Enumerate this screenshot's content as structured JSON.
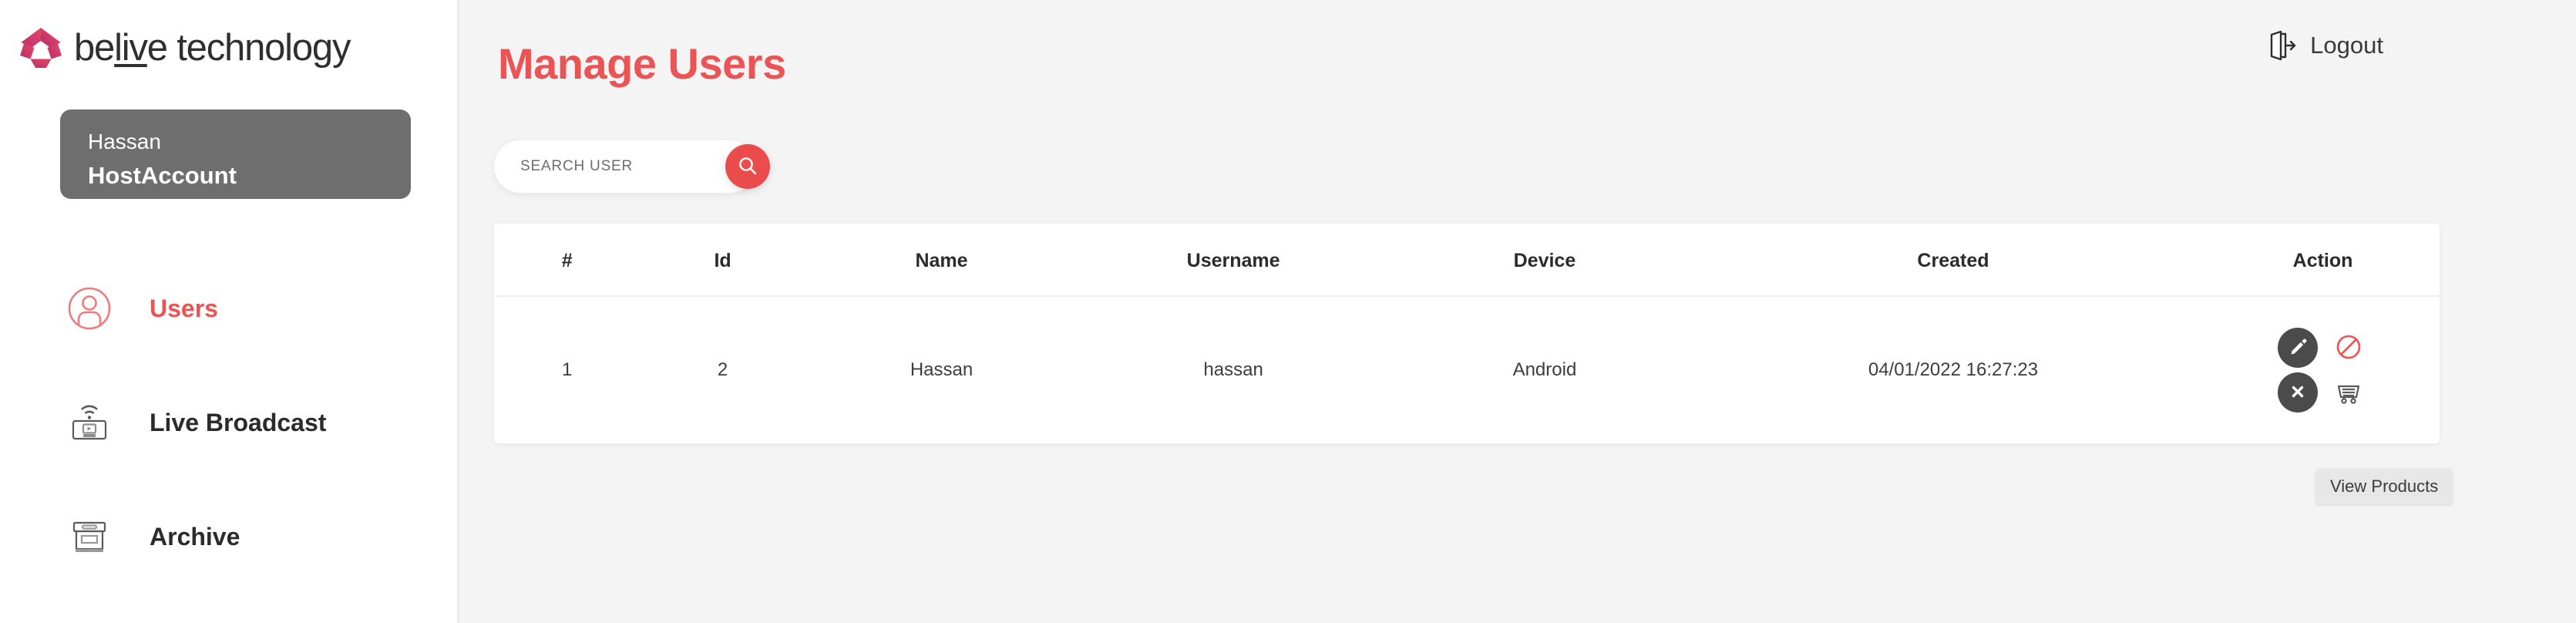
{
  "brand": {
    "name_part1": "be",
    "name_underlined": "liv",
    "name_part2": "e technology",
    "logo_icon": "pentagon-star-logo-icon",
    "colors": {
      "logo_from": "#c9336b",
      "logo_to": "#e0456a"
    }
  },
  "account": {
    "name": "Hassan",
    "role": "HostAccount"
  },
  "sidebar": {
    "items": [
      {
        "label": "Users",
        "icon": "user-circle-icon",
        "active": true
      },
      {
        "label": "Live Broadcast",
        "icon": "live-broadcast-icon",
        "active": false
      },
      {
        "label": "Archive",
        "icon": "archive-box-icon",
        "active": false
      }
    ]
  },
  "topbar": {
    "logout_label": "Logout",
    "logout_icon": "logout-door-arrow-icon"
  },
  "main": {
    "page_title": "Manage Users",
    "title_color": "#ea5455"
  },
  "search": {
    "placeholder": "SEARCH USER",
    "value": "",
    "button_icon": "search-icon",
    "button_color": "#ea4c4c"
  },
  "table": {
    "headers": [
      "#",
      "Id",
      "Name",
      "Username",
      "Device",
      "Created",
      "Action"
    ],
    "rows": [
      {
        "index": "1",
        "id": "2",
        "name": "Hassan",
        "username": "hassan",
        "device": "Android",
        "created": "04/01/2022 16:27:23",
        "actions": [
          {
            "name": "edit-button",
            "icon": "pencil-icon"
          },
          {
            "name": "block-button",
            "icon": "ban-icon"
          },
          {
            "name": "delete-button",
            "icon": "close-x-icon"
          },
          {
            "name": "view-products-button",
            "icon": "shopping-cart-icon"
          }
        ]
      }
    ]
  },
  "tooltip": {
    "text": "View Products"
  }
}
